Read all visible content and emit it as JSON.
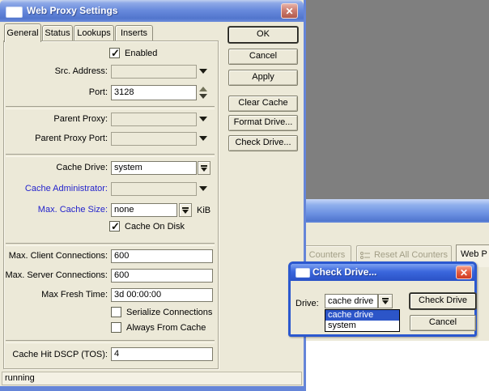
{
  "main_window": {
    "title": "Web Proxy Settings",
    "tabs": [
      "General",
      "Status",
      "Lookups",
      "Inserts"
    ],
    "action_buttons": [
      "OK",
      "Cancel",
      "Apply",
      "Clear Cache",
      "Format Drive...",
      "Check Drive..."
    ],
    "form": {
      "enabled": {
        "label": "Enabled",
        "checked": true
      },
      "src_address": {
        "label": "Src. Address:",
        "value": ""
      },
      "port": {
        "label": "Port:",
        "value": "3128"
      },
      "parent_proxy": {
        "label": "Parent Proxy:",
        "value": ""
      },
      "parent_proxy_port": {
        "label": "Parent Proxy Port:",
        "value": ""
      },
      "cache_drive": {
        "label": "Cache Drive:",
        "value": "system"
      },
      "cache_administrator": {
        "label": "Cache Administrator:",
        "value": ""
      },
      "max_cache_size": {
        "label": "Max. Cache Size:",
        "value": "none",
        "unit": "KiB"
      },
      "cache_on_disk": {
        "label": "Cache On Disk",
        "checked": true
      },
      "max_client_connections": {
        "label": "Max. Client Connections:",
        "value": "600"
      },
      "max_server_connections": {
        "label": "Max. Server Connections:",
        "value": "600"
      },
      "max_fresh_time": {
        "label": "Max Fresh Time:",
        "value": "3d 00:00:00"
      },
      "serialize_connections": {
        "label": "Serialize Connections",
        "checked": false
      },
      "always_from_cache": {
        "label": "Always From Cache",
        "checked": false
      },
      "cache_hit_dscp": {
        "label": "Cache Hit DSCP (TOS):",
        "value": "4"
      }
    },
    "status_bar": "running"
  },
  "check_drive_window": {
    "title": "Check Drive...",
    "drive": {
      "label": "Drive:",
      "value": "cache drive"
    },
    "dropdown_options": [
      "cache drive",
      "system"
    ],
    "selected_option": "cache drive",
    "buttons": [
      "Check Drive",
      "Cancel"
    ]
  },
  "background_window": {
    "toolbar_buttons": [
      "Counters",
      "Reset All Counters"
    ],
    "partial_tab": "Web P"
  },
  "colors": {
    "active_title_blue": "#2b58cf",
    "inactive_title_blue": "#6789dc",
    "dialog_face": "#ece9d8",
    "desktop_gray": "#7f7f7f",
    "selection_blue": "#2c55c8",
    "close_red": "#cf3a22",
    "changed_label_blue": "#2323cc"
  }
}
